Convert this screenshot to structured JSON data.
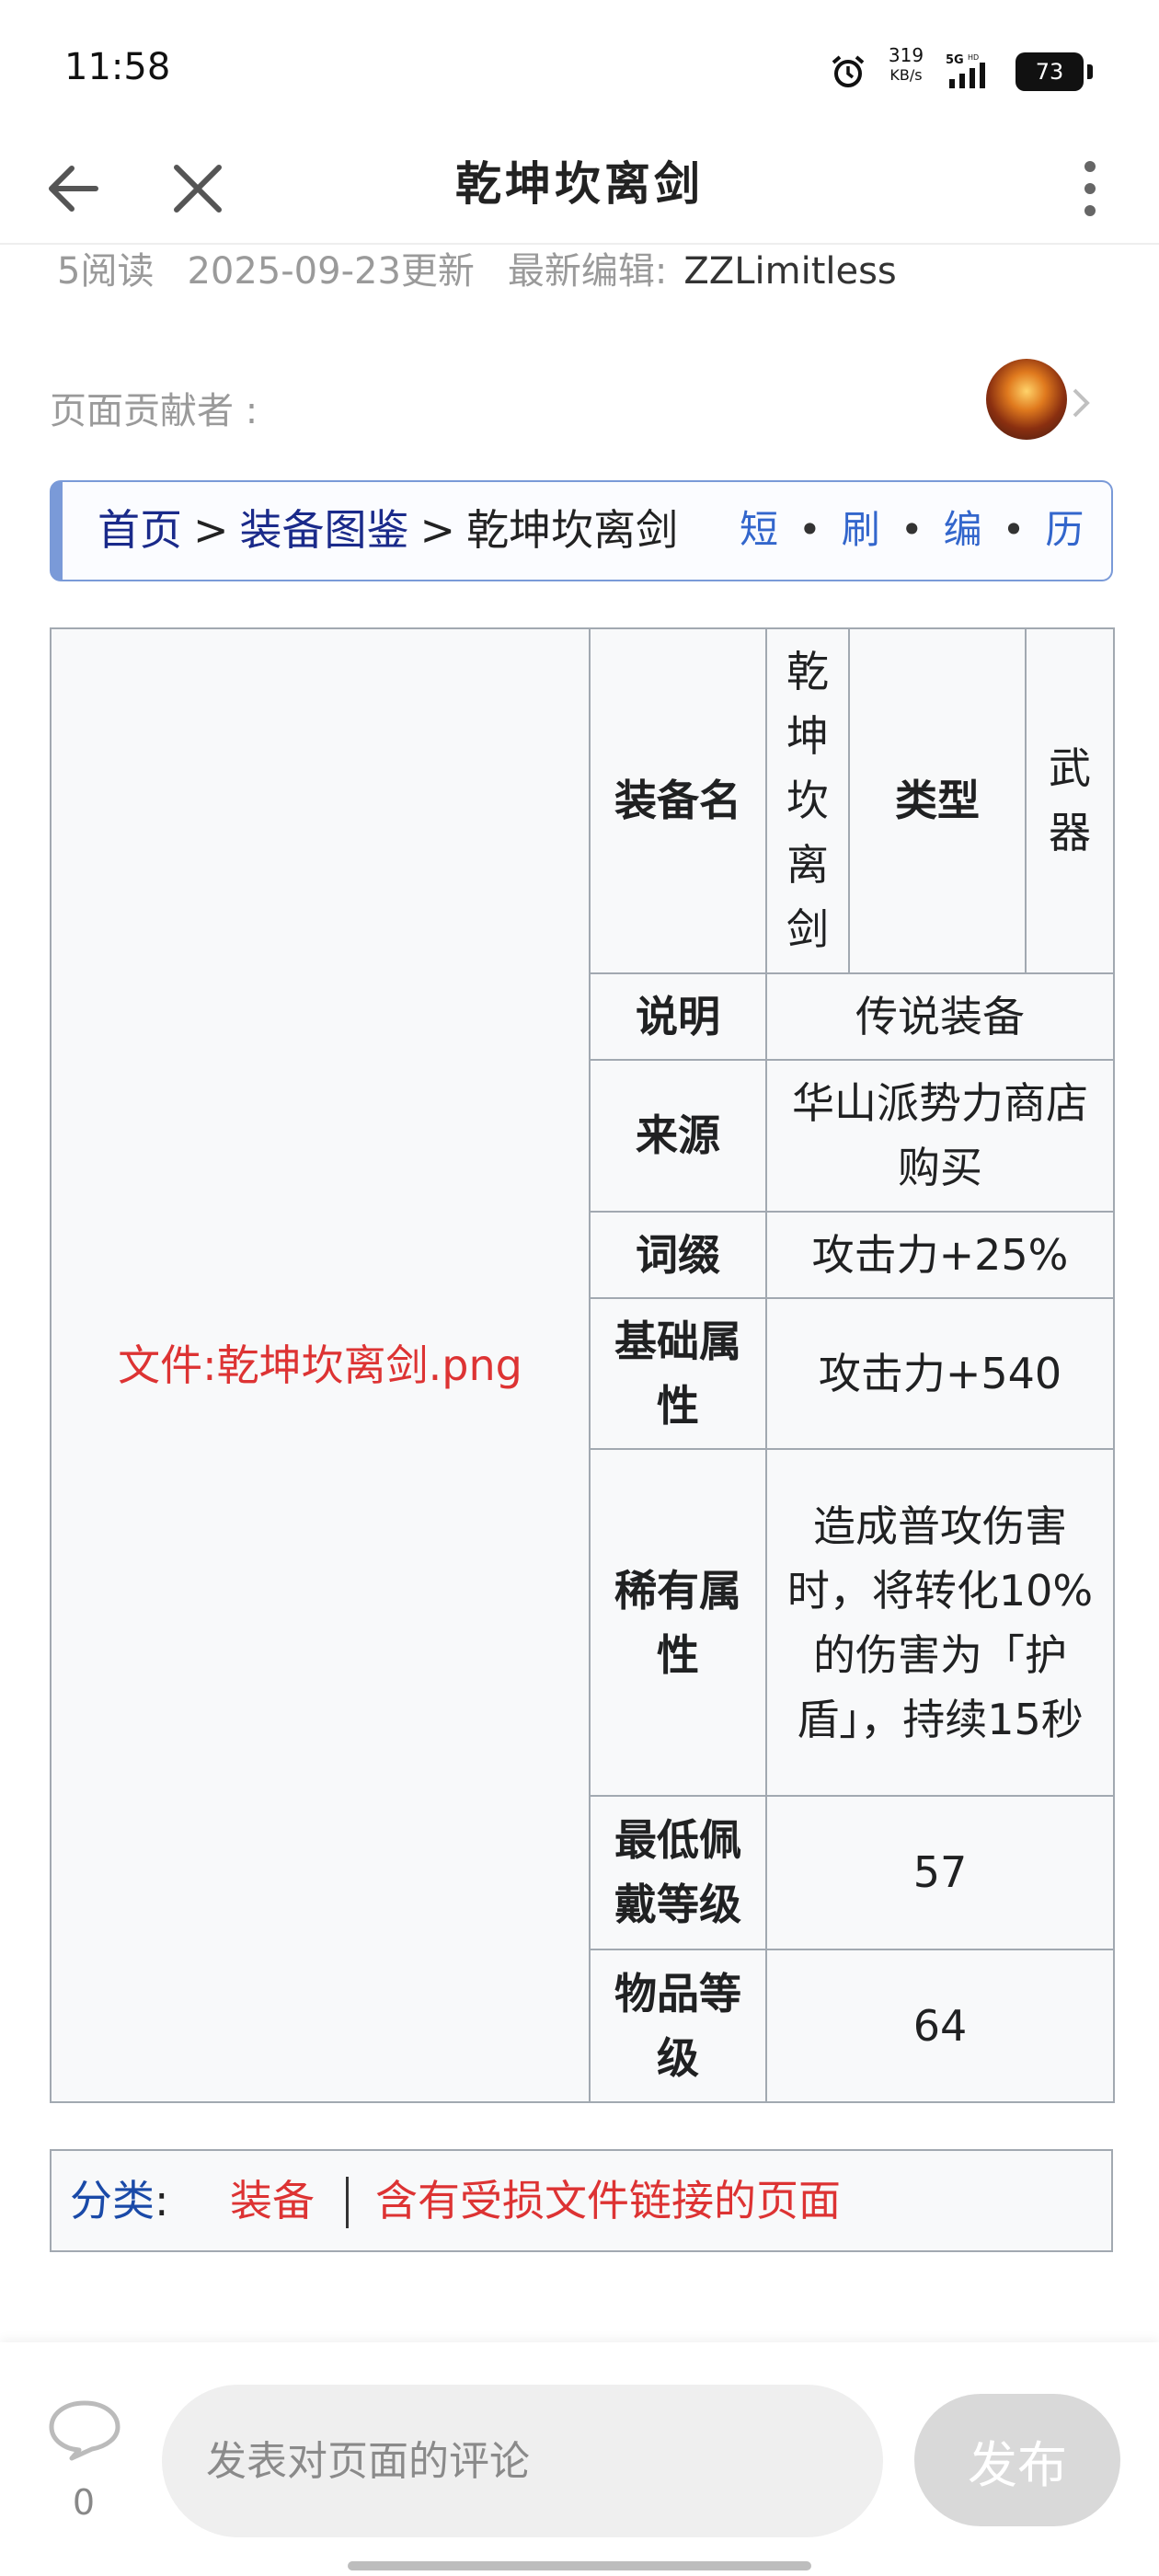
{
  "status_bar": {
    "time": "11:58",
    "net_speed": "319",
    "net_unit": "KB/s",
    "network": "5G HD",
    "battery": "73"
  },
  "app_bar": {
    "title": "乾坤坎离剑"
  },
  "meta": {
    "reads": "5阅读",
    "updated": "2025-09-23更新",
    "editor_label": "最新编辑:",
    "editor": "ZZLimitless",
    "contributors_label": "页面贡献者 :"
  },
  "breadcrumb": {
    "home": "首页",
    "sep": ">",
    "section": "装备图鉴",
    "current": "乾坤坎离剑",
    "tools": [
      "短",
      "刷",
      "编",
      "历"
    ],
    "dot": "•"
  },
  "infobox": {
    "image_text": "文件:乾坤坎离剑.png",
    "name_label": "装备名",
    "name_value": [
      "乾",
      "坤",
      "坎",
      "离",
      "剑"
    ],
    "type_label": "类型",
    "type_value": [
      "武",
      "器"
    ],
    "rows": [
      {
        "label": "说明",
        "value": "传说装备"
      },
      {
        "label": "来源",
        "value": "华山派势力商店购买"
      },
      {
        "label": "词缀",
        "value": "攻击力+25%"
      },
      {
        "label": "基础属性",
        "value": "攻击力+540"
      },
      {
        "label": "稀有属性",
        "value": "造成普攻伤害时，将转化10%的伤害为「护盾」，持续15秒"
      },
      {
        "label": "最低佩戴等级",
        "value": "57"
      },
      {
        "label": "物品等级",
        "value": "64"
      }
    ]
  },
  "categories": {
    "label": "分类",
    "colon": ":",
    "items": [
      "装备",
      "含有受损文件链接的页面"
    ]
  },
  "bottom_bar": {
    "comment_count": "0",
    "comment_placeholder": "发表对页面的评论",
    "publish_label": "发布"
  },
  "colors": {
    "link_blue": "#3366cc",
    "red_link": "#dd3333",
    "crumb_border": "#7a9ad8",
    "table_border": "#a2a9b1"
  }
}
